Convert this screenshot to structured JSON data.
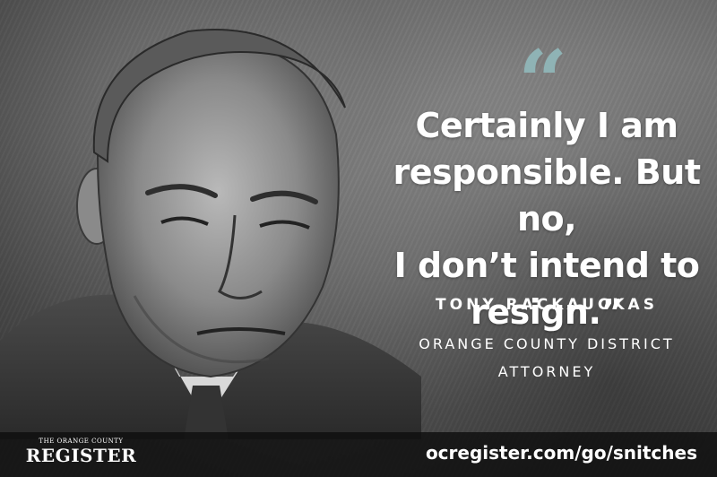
{
  "quote": {
    "mark": "“",
    "lines": [
      "Certainly I am",
      "responsible. But no,",
      "I don’t intend to",
      "resign.”"
    ]
  },
  "speaker": {
    "name": "TONY RACKAUCKAS",
    "title_lines": [
      "ORANGE COUNTY DISTRICT",
      "ATTORNEY"
    ]
  },
  "footer": {
    "logo_top": "THE ORANGE COUNTY",
    "logo_main": "REGISTER",
    "url": "ocregister.com/go/snitches"
  },
  "colors": {
    "quote_mark": "#8fb3b5",
    "text": "#ffffff",
    "footer_bg": "#0f0f0f"
  },
  "images": {
    "portrait": "pencil-sketch-portrait-of-speaker"
  }
}
